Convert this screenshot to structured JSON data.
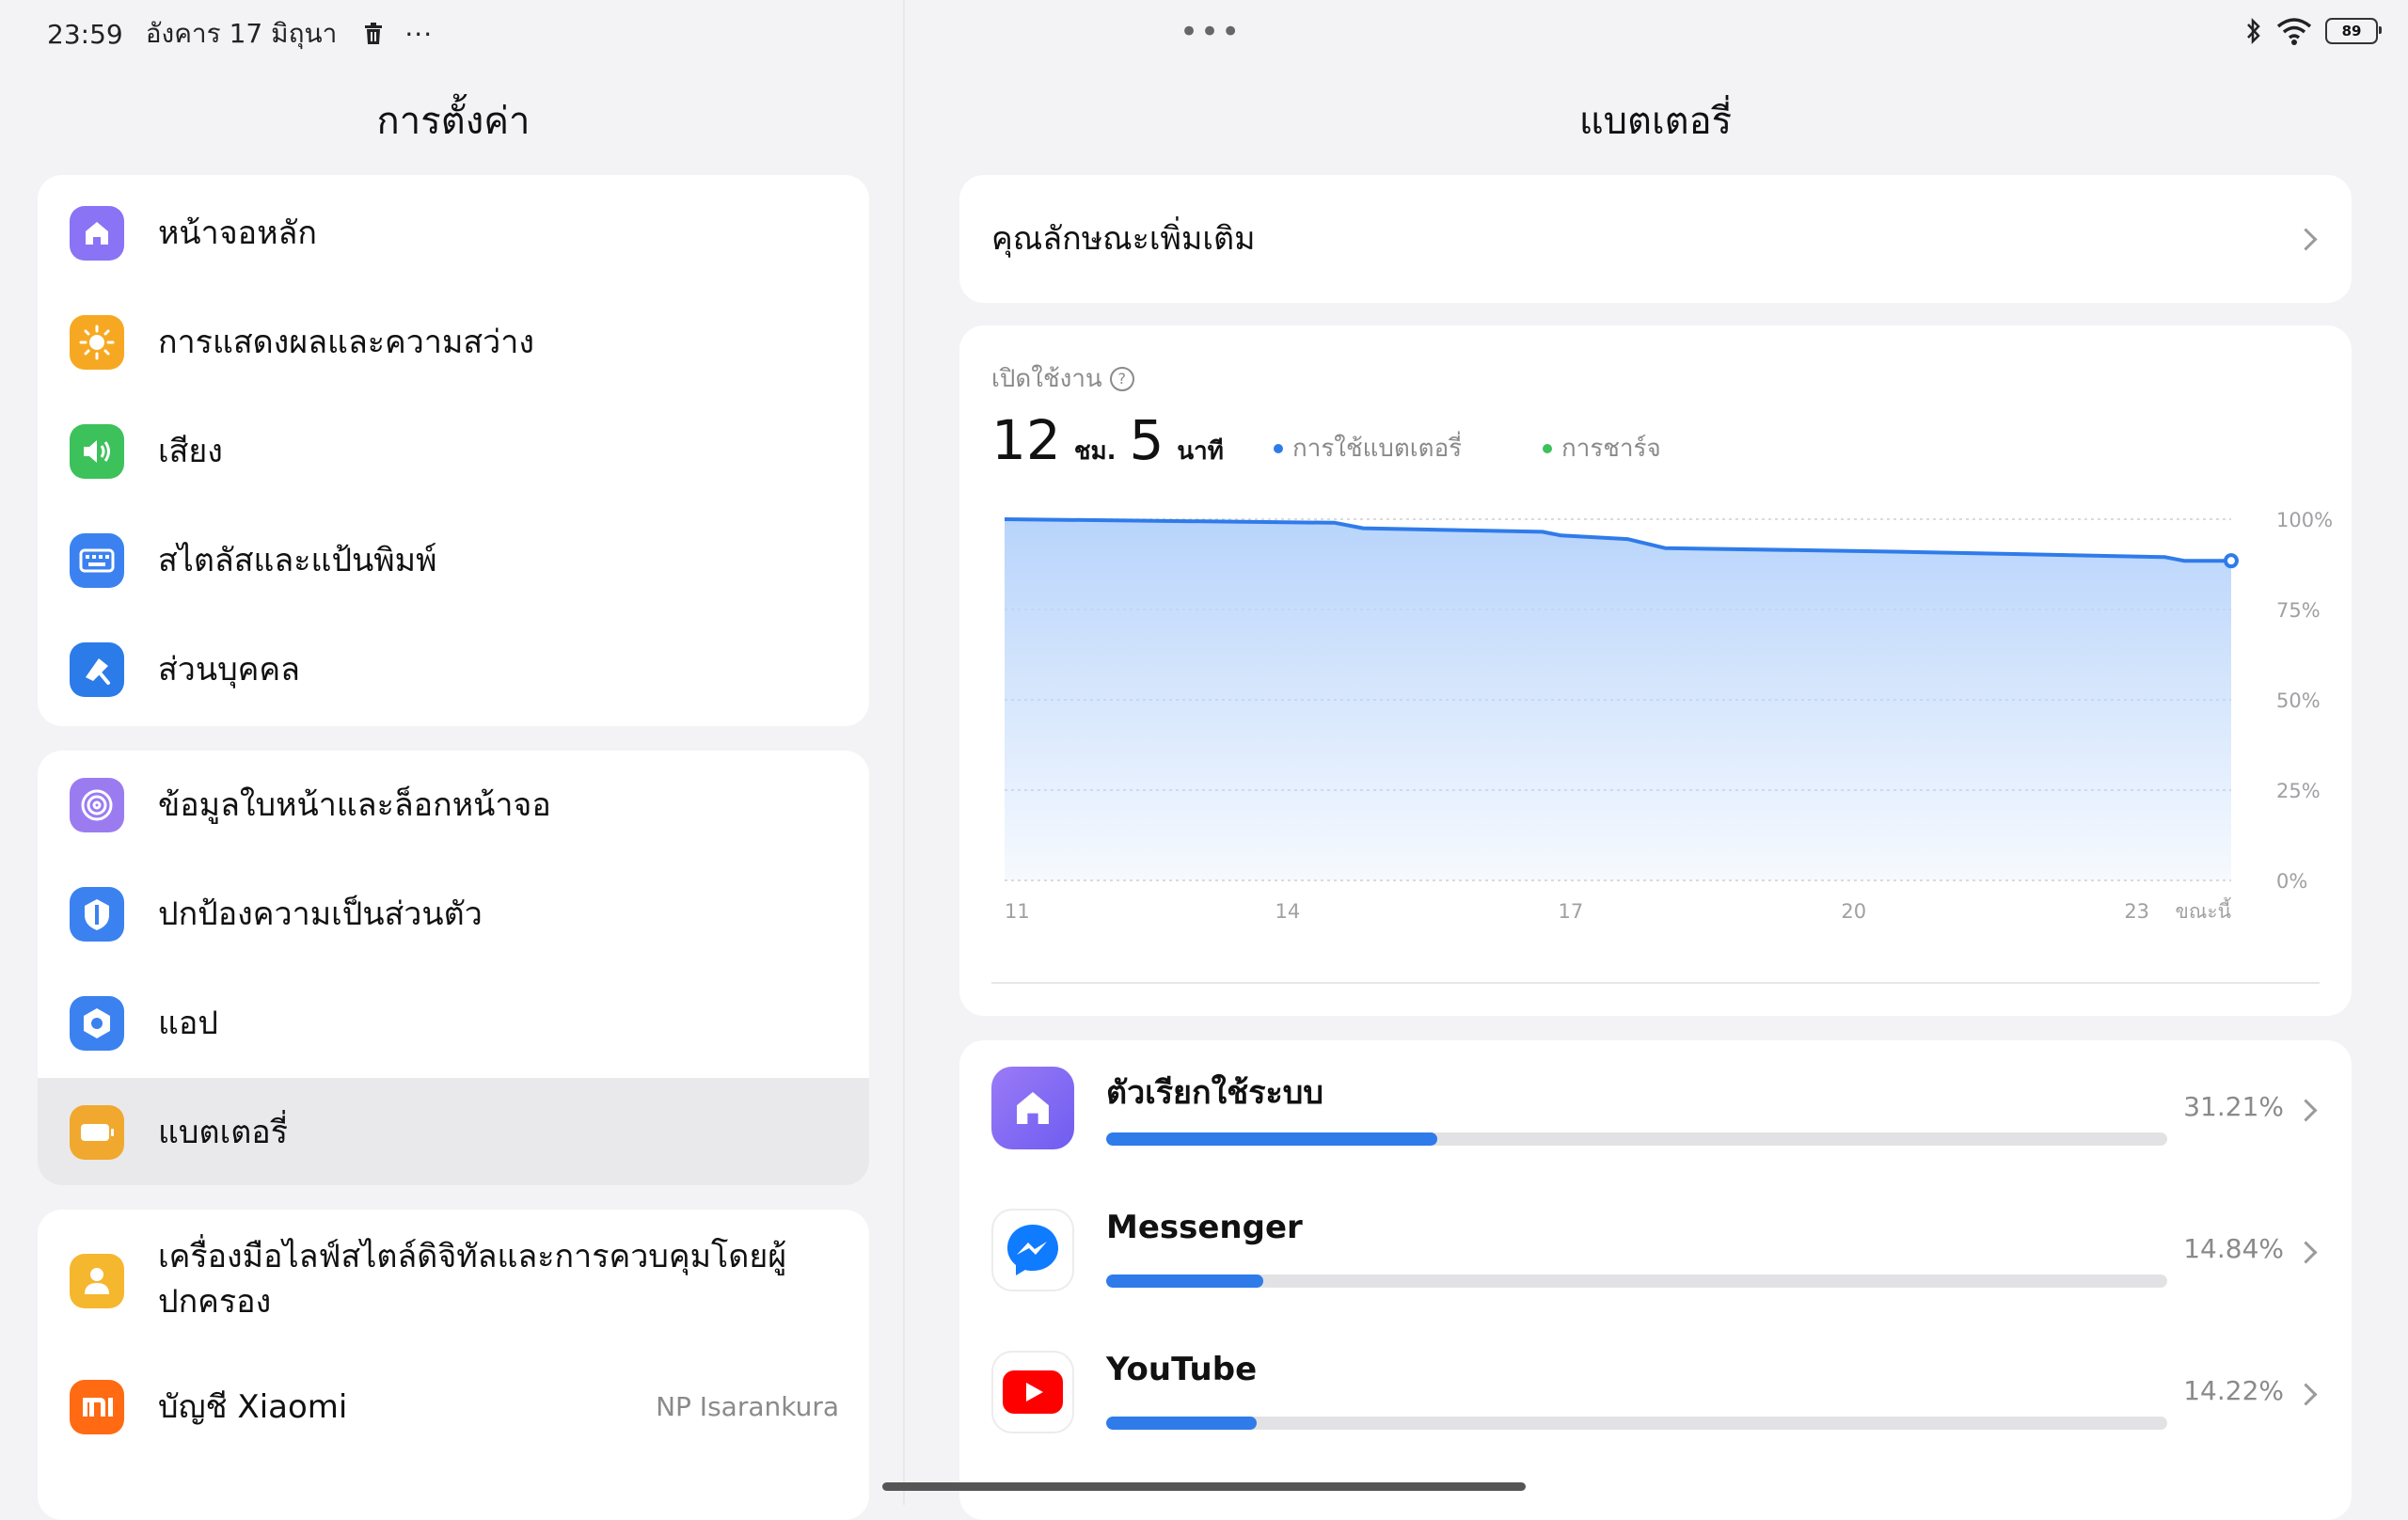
{
  "status_bar": {
    "time": "23:59",
    "date": "อังคาร 17 มิถุนา",
    "more": "···",
    "center_more": "•••",
    "battery_level": "89"
  },
  "settings": {
    "title": "การตั้งค่า",
    "group1": [
      {
        "label": "หน้าจอหลัก",
        "icon": "home-icon",
        "color": "#8a73f5"
      },
      {
        "label": "การแสดงผลและความสว่าง",
        "icon": "sun-icon",
        "color": "#f7a823"
      },
      {
        "label": "เสียง",
        "icon": "speaker-icon",
        "color": "#3cc15b"
      },
      {
        "label": "สไตลัสและแป้นพิมพ์",
        "icon": "keyboard-icon",
        "color": "#3b82f0"
      },
      {
        "label": "ส่วนบุคคล",
        "icon": "brush-icon",
        "color": "#2b7be8"
      }
    ],
    "group2": [
      {
        "label": "ข้อมูลใบหน้าและล็อกหน้าจอ",
        "icon": "fingerprint-icon",
        "color": "#9b7cf0"
      },
      {
        "label": "ปกป้องความเป็นส่วนตัว",
        "icon": "privacy-shield-icon",
        "color": "#3b82f0"
      },
      {
        "label": "แอป",
        "icon": "apps-gear-icon",
        "color": "#3b82f0"
      },
      {
        "label": "แบตเตอรี่",
        "icon": "battery-icon",
        "color": "#f0a92e",
        "active": true
      }
    ],
    "group3": [
      {
        "label": "เครื่องมือไลฟ์สไตล์ดิจิทัลและการควบคุมโดยผู้ปกครอง",
        "icon": "parental-icon",
        "color": "#f5b72e"
      },
      {
        "label": "บัญชี Xiaomi",
        "icon": "mi-logo-icon",
        "color": "#ff6a13",
        "value": "NP Isarankura"
      }
    ]
  },
  "battery": {
    "title": "แบตเตอรี่",
    "features_label": "คุณลักษณะเพิ่มเติม",
    "screen_on_label": "เปิดใช้งาน",
    "hours": "12",
    "hours_unit": "ชม.",
    "minutes": "5",
    "minutes_unit": "นาที",
    "legend": [
      {
        "label": "การใช้แบตเตอรี่",
        "color": "#2f7bea"
      },
      {
        "label": "การชาร์จ",
        "color": "#3cc15b"
      }
    ],
    "apps": [
      {
        "name": "ตัวเรียกใช้ระบบ",
        "percent_label": "31.21%",
        "fraction": 0.3121,
        "icon": "home-icon"
      },
      {
        "name": "Messenger",
        "percent_label": "14.84%",
        "fraction": 0.1484,
        "icon": "messenger-icon"
      },
      {
        "name": "YouTube",
        "percent_label": "14.22%",
        "fraction": 0.1422,
        "icon": "youtube-icon"
      }
    ]
  },
  "chart_data": {
    "type": "area",
    "x_tick_labels": [
      "11",
      "14",
      "17",
      "20",
      "23",
      "ขณะนี้"
    ],
    "y_tick_labels": [
      "100%",
      "75%",
      "50%",
      "25%",
      "0%"
    ],
    "ylim": [
      0,
      100
    ],
    "xlim": [
      11,
      24
    ],
    "series": [
      {
        "x": [
          11,
          14.5,
          14.8,
          16.7,
          16.9,
          17.6,
          18.0,
          20.5,
          23.3,
          23.5,
          24
        ],
        "y": [
          100,
          99,
          97.5,
          96.5,
          95.5,
          94.5,
          92,
          91,
          89.5,
          88.5,
          88.5
        ]
      }
    ],
    "grid": true,
    "line_color": "#2f7bea"
  }
}
